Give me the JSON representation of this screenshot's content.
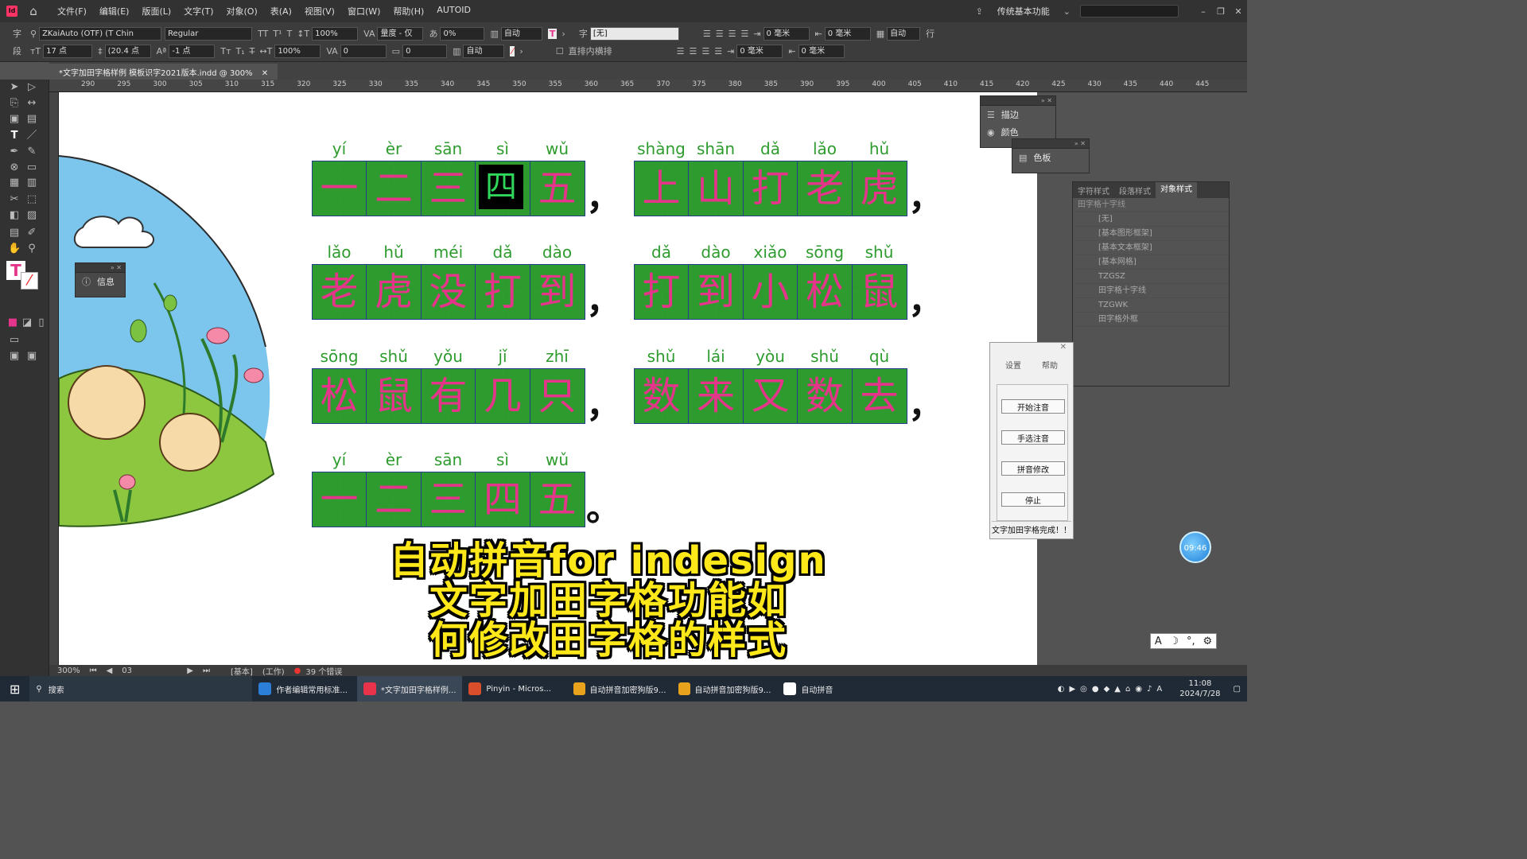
{
  "menubar": {
    "app_logo": "Id",
    "items": [
      "文件(F)",
      "编辑(E)",
      "版面(L)",
      "文字(T)",
      "对象(O)",
      "表(A)",
      "视图(V)",
      "窗口(W)",
      "帮助(H)",
      "AUTOID"
    ],
    "workspace": "传统基本功能"
  },
  "control": {
    "font_family": "ZKaiAuto (OTF) (T Chin",
    "font_style": "Regular",
    "font_size": "17 点",
    "leading": "(20.4 点",
    "scale_v": "100%",
    "scale_h": "100%",
    "tracking_label": "量度 - 仅",
    "tracking": "0%",
    "baseline": "-1 点",
    "kerning": "0",
    "tsume": "0",
    "auto1": "自动",
    "auto2": "自动",
    "char_style": "[无]",
    "checkbox_label": "直排内横排",
    "indent_a": "0 毫米",
    "indent_b": "0 毫米",
    "indent_c": "0 毫米",
    "indent_d": "0 毫米",
    "auto3": "自动",
    "line_label": "行"
  },
  "document": {
    "tab_title": "*文字加田字格样例  模板识字2021版本.indd @ 300%"
  },
  "ruler": {
    "ticks": [
      "290",
      "295",
      "300",
      "305",
      "310",
      "315",
      "320",
      "325",
      "330",
      "335",
      "340",
      "345",
      "350",
      "355",
      "360",
      "365",
      "370",
      "375",
      "380",
      "385",
      "390",
      "395",
      "400",
      "405",
      "410",
      "415",
      "420",
      "425",
      "430",
      "435",
      "440",
      "445"
    ]
  },
  "poem": {
    "rows": [
      {
        "left": [
          {
            "py": "yí",
            "hz": "一"
          },
          {
            "py": "èr",
            "hz": "二"
          },
          {
            "py": "sān",
            "hz": "三"
          },
          {
            "py": "sì",
            "hz": "四",
            "sel": true
          },
          {
            "py": "wǔ",
            "hz": "五"
          }
        ],
        "left_punct": "，",
        "right": [
          {
            "py": "shàng",
            "hz": "上"
          },
          {
            "py": "shān",
            "hz": "山"
          },
          {
            "py": "dǎ",
            "hz": "打"
          },
          {
            "py": "lǎo",
            "hz": "老"
          },
          {
            "py": "hǔ",
            "hz": "虎"
          }
        ],
        "right_punct": "，"
      },
      {
        "left": [
          {
            "py": "lǎo",
            "hz": "老"
          },
          {
            "py": "hǔ",
            "hz": "虎"
          },
          {
            "py": "méi",
            "hz": "没"
          },
          {
            "py": "dǎ",
            "hz": "打"
          },
          {
            "py": "dào",
            "hz": "到"
          }
        ],
        "left_punct": "，",
        "right": [
          {
            "py": "dǎ",
            "hz": "打"
          },
          {
            "py": "dào",
            "hz": "到"
          },
          {
            "py": "xiǎo",
            "hz": "小"
          },
          {
            "py": "sōng",
            "hz": "松"
          },
          {
            "py": "shǔ",
            "hz": "鼠"
          }
        ],
        "right_punct": "，"
      },
      {
        "left": [
          {
            "py": "sōng",
            "hz": "松"
          },
          {
            "py": "shǔ",
            "hz": "鼠"
          },
          {
            "py": "yǒu",
            "hz": "有"
          },
          {
            "py": "jǐ",
            "hz": "几"
          },
          {
            "py": "zhī",
            "hz": "只"
          }
        ],
        "left_punct": "，",
        "right": [
          {
            "py": "shǔ",
            "hz": "数"
          },
          {
            "py": "lái",
            "hz": "来"
          },
          {
            "py": "yòu",
            "hz": "又"
          },
          {
            "py": "shǔ",
            "hz": "数"
          },
          {
            "py": "qù",
            "hz": "去"
          }
        ],
        "right_punct": "，"
      },
      {
        "left": [
          {
            "py": "yí",
            "hz": "一"
          },
          {
            "py": "èr",
            "hz": "二"
          },
          {
            "py": "sān",
            "hz": "三"
          },
          {
            "py": "sì",
            "hz": "四"
          },
          {
            "py": "wǔ",
            "hz": "五"
          }
        ],
        "left_punct": "。"
      }
    ]
  },
  "panels": {
    "stroke": "描边",
    "color": "颜色",
    "swatches": "色板",
    "info": "信息"
  },
  "object_styles": {
    "tabs": [
      "字符样式",
      "段落样式",
      "对象样式"
    ],
    "current": "田字格十字线",
    "items": [
      "[无]",
      "[基本图形框架]",
      "[基本文本框架]",
      "[基本网格]",
      "TZGSZ",
      "田字格十字线",
      "TZGWK",
      "田字格外框"
    ]
  },
  "plugin": {
    "menu_settings": "设置",
    "menu_help": "帮助",
    "btn_start": "开始注音",
    "btn_manual": "手选注音",
    "btn_modify": "拼音修改",
    "btn_stop": "停止",
    "status": "文字加田字格完成！！"
  },
  "statusbar": {
    "zoom": "300%",
    "page": "03",
    "style": "[基本]",
    "mode": "(工作)",
    "errors": "39 个错误"
  },
  "subtitle": {
    "line1": "自动拼音for indesign",
    "line2": "文字加田字格功能如",
    "line3": "何修改田字格的样式"
  },
  "timer": "09:46",
  "taskbar": {
    "search": "搜索",
    "apps": [
      "作者编辑常用标准...",
      "*文字加田字格样例...",
      "Pinyin - Micros...",
      "自动拼音加密狗版9...",
      "自动拼音加密狗版9...",
      "自动拼音"
    ],
    "time": "11:08",
    "date": "2024/7/28"
  },
  "colors": {
    "hanzi": "#e5358a",
    "pinyin": "#2e9b2e",
    "grid": "#243f8a",
    "subtitle": "#ffe81a"
  }
}
